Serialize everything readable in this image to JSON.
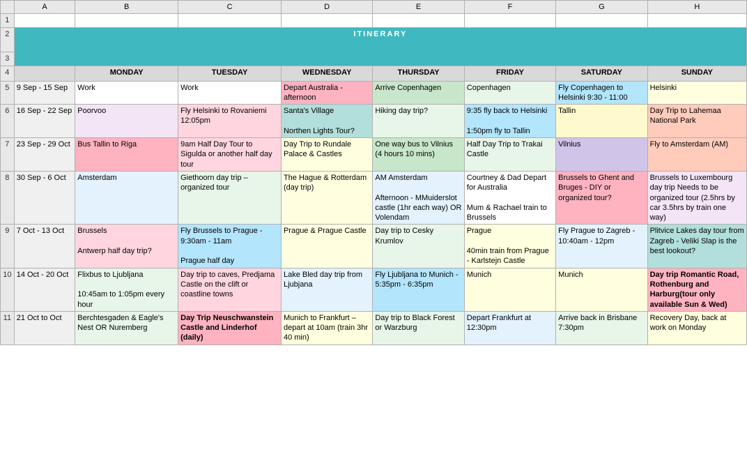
{
  "title": "ITINERARY",
  "columns": {
    "row": "",
    "a": "A",
    "b": "B",
    "c": "C",
    "d": "D",
    "e": "E",
    "f": "F",
    "g": "G",
    "h": "H"
  },
  "day_headers": {
    "monday": "MONDAY",
    "tuesday": "TUESDAY",
    "wednesday": "WEDNESDAY",
    "thursday": "THURSDAY",
    "friday": "FRIDAY",
    "saturday": "SATURDAY",
    "sunday": "SUNDAY"
  },
  "weeks": [
    {
      "row": "5",
      "date": "9 Sep - 15 Sep",
      "monday": "Work",
      "tuesday": "Work",
      "wednesday": "Depart Australia - afternoon",
      "thursday": "Arrive Copenhagen",
      "friday": "Copenhagen",
      "saturday": "Fly Copenhagen to Helsinki 9:30 - 11:00",
      "sunday": "Helsinki"
    },
    {
      "row": "6",
      "date": "16 Sep - 22 Sep",
      "monday": "Poorvoo",
      "tuesday": "Fly Helsinki to Rovaniemi 12:05pm",
      "wednesday": "Santa's Village\n\nNorthen Lights Tour?",
      "thursday": "Hiking day trip?",
      "friday": "9:35 fly back to Helsinki\n\n1:50pm fly to Tallin",
      "saturday": "Tallin",
      "sunday": "Day Trip to Lahemaa National Park"
    },
    {
      "row": "7",
      "date": "23 Sep - 29 Oct",
      "monday": "Bus Tallin to Riga",
      "tuesday": "9am Half Day Tour to Sigulda or another half day tour",
      "wednesday": "Day Trip to Rundale Palace & Castles",
      "thursday": "One way bus to Vilnius (4 hours 10 mins)",
      "friday": "Half Day Trip to Trakai Castle",
      "saturday": "Vilnius",
      "sunday": "Fly to Amsterdam (AM)"
    },
    {
      "row": "8",
      "date": "30 Sep - 6 Oct",
      "monday": "Amsterdam",
      "tuesday": "Giethoorn day trip – organized tour",
      "wednesday": "The Hague & Rotterdam (day trip)",
      "thursday": "AM Amsterdam\n\nAfternoon - MMuiderslot castle (1hr each way) OR Volendam",
      "friday": "Courtney & Dad Depart for Australia\n\nMum & Rachael train to Brussels",
      "saturday": "Brussels to Ghent and Bruges - DIY or organized tour?",
      "sunday": "Brussels to Luxembourg day trip Needs to be organized tour (2.5hrs by car 3.5hrs by train one way)"
    },
    {
      "row": "9",
      "date": "7 Oct - 13 Oct",
      "monday": "Brussels\n\nAntwerp half day trip?",
      "tuesday": "Fly Brussels to Prague - 9:30am - 11am\n\nPrague half day",
      "wednesday": "Prague & Prague Castle",
      "thursday": "Day trip to Cesky Krumlov",
      "friday": "Prague\n\n40min train from Prague - Karlstejn Castle",
      "saturday": "Fly Prague to Zagreb - 10:40am - 12pm",
      "sunday": "Plitvice Lakes day tour from Zagreb - Veliki Slap is the best lookout?"
    },
    {
      "row": "10",
      "date": "14 Oct - 20 Oct",
      "monday": "Flixbus to Ljubljana\n\n10:45am to 1:05pm every hour",
      "tuesday": "Day trip to caves, Predjama Castle on the clift or coastline towns",
      "wednesday": "Lake Bled day trip from Ljubjana",
      "thursday": "Fly Ljubljana to Munich - 5:35pm - 6:35pm",
      "friday": "Munich",
      "saturday": "Munich",
      "sunday": "Day trip Romantic Road, Rothenburg and Harburg(tour only available Sun & Wed)"
    },
    {
      "row": "11",
      "date": "21 Oct to Oct",
      "monday": "Berchtesgaden & Eagle's Nest OR Nuremberg",
      "tuesday": "Day Trip Neuschwanstein Castle and Linderhof (daily)",
      "wednesday": "Munich to Frankfurt – depart at 10am (train 3hr 40 min)",
      "thursday": "Day trip to Black Forest or Warzburg",
      "friday": "Depart Frankfurt at 12:30pm",
      "saturday": "Arrive back in Brisbane 7:30pm",
      "sunday": "Recovery Day, back at work on Monday"
    }
  ]
}
